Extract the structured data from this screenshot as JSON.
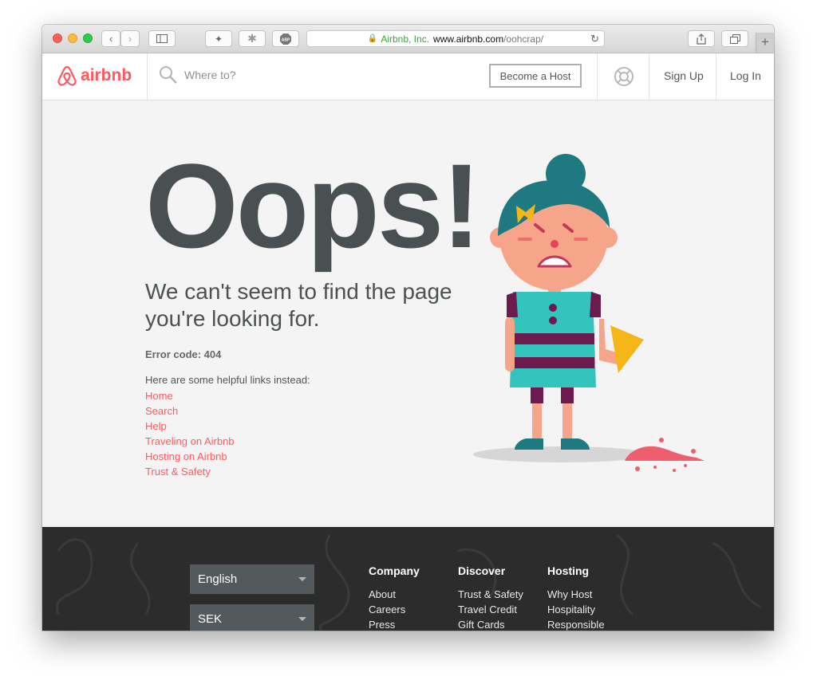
{
  "browser": {
    "url_org": "Airbnb, Inc.",
    "url_host": "www.airbnb.com",
    "url_path": "/oohcrap/",
    "new_tab": "+"
  },
  "header": {
    "logo_text": "airbnb",
    "search_placeholder": "Where to?",
    "become_host": "Become a Host",
    "sign_up": "Sign Up",
    "log_in": "Log In"
  },
  "main": {
    "headline": "Oops!",
    "message": "We can't seem to find the page you're looking for.",
    "error_code": "Error code: 404",
    "links_intro": "Here are some helpful links instead:",
    "links": [
      "Home",
      "Search",
      "Help",
      "Traveling on Airbnb",
      "Hosting on Airbnb",
      "Trust & Safety"
    ]
  },
  "footer": {
    "language": "English",
    "currency": "SEK",
    "columns": [
      {
        "title": "Company",
        "items": [
          "About",
          "Careers",
          "Press"
        ]
      },
      {
        "title": "Discover",
        "items": [
          "Trust & Safety",
          "Travel Credit",
          "Gift Cards"
        ]
      },
      {
        "title": "Hosting",
        "items": [
          "Why Host",
          "Hospitality",
          "Responsible"
        ]
      }
    ]
  },
  "colors": {
    "brand": "#ff5a5f",
    "text_dark": "#4a4f52",
    "footer_bg": "#2c2c2c"
  },
  "icons": [
    "back-icon",
    "forward-icon",
    "sidebar-icon",
    "extension-icon",
    "abp-icon",
    "lock-icon",
    "reload-icon",
    "share-icon",
    "tabs-icon",
    "search-icon",
    "help-lifebuoy-icon"
  ]
}
